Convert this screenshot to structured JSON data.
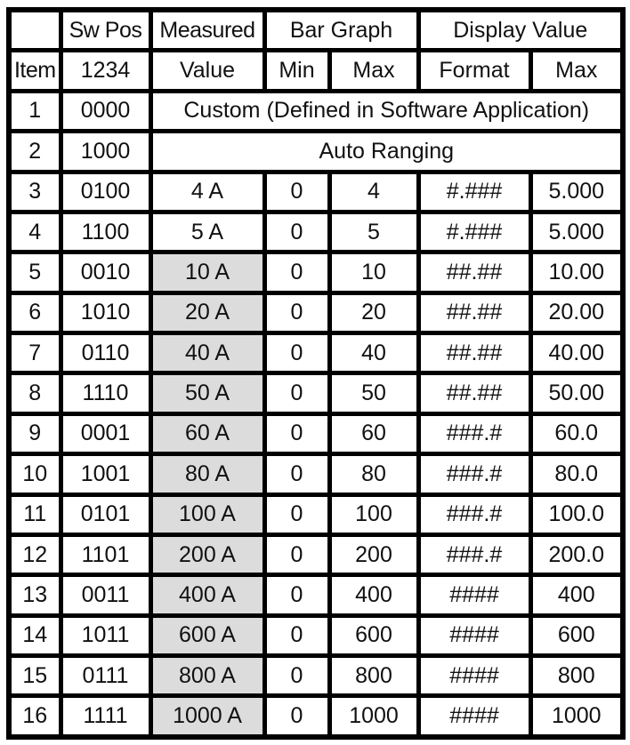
{
  "table": {
    "header_row1": {
      "blank": "",
      "sw_pos": "Sw Pos",
      "measured": "Measured",
      "bar_graph": "Bar Graph",
      "display_value": "Display Value"
    },
    "header_row2": {
      "item": "Item",
      "sw_bits": "1234",
      "value": "Value",
      "min": "Min",
      "max": "Max",
      "format": "Format",
      "display_max": "Max"
    },
    "special_rows": [
      {
        "item": "1",
        "sw": "0000",
        "text": "Custom (Defined in Software Application)"
      },
      {
        "item": "2",
        "sw": "1000",
        "text": "Auto Ranging"
      }
    ],
    "rows": [
      {
        "item": "3",
        "sw": "0100",
        "value": "4 A",
        "min": "0",
        "max": "4",
        "format": "#.###",
        "dmax": "5.000",
        "shaded": false
      },
      {
        "item": "4",
        "sw": "1100",
        "value": "5 A",
        "min": "0",
        "max": "5",
        "format": "#.###",
        "dmax": "5.000",
        "shaded": false
      },
      {
        "item": "5",
        "sw": "0010",
        "value": "10 A",
        "min": "0",
        "max": "10",
        "format": "##.##",
        "dmax": "10.00",
        "shaded": true
      },
      {
        "item": "6",
        "sw": "1010",
        "value": "20 A",
        "min": "0",
        "max": "20",
        "format": "##.##",
        "dmax": "20.00",
        "shaded": true
      },
      {
        "item": "7",
        "sw": "0110",
        "value": "40 A",
        "min": "0",
        "max": "40",
        "format": "##.##",
        "dmax": "40.00",
        "shaded": true
      },
      {
        "item": "8",
        "sw": "1110",
        "value": "50 A",
        "min": "0",
        "max": "50",
        "format": "##.##",
        "dmax": "50.00",
        "shaded": true
      },
      {
        "item": "9",
        "sw": "0001",
        "value": "60 A",
        "min": "0",
        "max": "60",
        "format": "###.#",
        "dmax": "60.0",
        "shaded": true
      },
      {
        "item": "10",
        "sw": "1001",
        "value": "80 A",
        "min": "0",
        "max": "80",
        "format": "###.#",
        "dmax": "80.0",
        "shaded": true
      },
      {
        "item": "11",
        "sw": "0101",
        "value": "100 A",
        "min": "0",
        "max": "100",
        "format": "###.#",
        "dmax": "100.0",
        "shaded": true
      },
      {
        "item": "12",
        "sw": "1101",
        "value": "200 A",
        "min": "0",
        "max": "200",
        "format": "###.#",
        "dmax": "200.0",
        "shaded": true
      },
      {
        "item": "13",
        "sw": "0011",
        "value": "400 A",
        "min": "0",
        "max": "400",
        "format": "####",
        "dmax": "400",
        "shaded": true
      },
      {
        "item": "14",
        "sw": "1011",
        "value": "600 A",
        "min": "0",
        "max": "600",
        "format": "####",
        "dmax": "600",
        "shaded": true
      },
      {
        "item": "15",
        "sw": "0111",
        "value": "800 A",
        "min": "0",
        "max": "800",
        "format": "####",
        "dmax": "800",
        "shaded": true
      },
      {
        "item": "16",
        "sw": "1111",
        "value": "1000 A",
        "min": "0",
        "max": "1000",
        "format": "####",
        "dmax": "1000",
        "shaded": true
      }
    ],
    "colors": {
      "shaded_cell": "#dcdcdc",
      "border": "#000000"
    }
  }
}
